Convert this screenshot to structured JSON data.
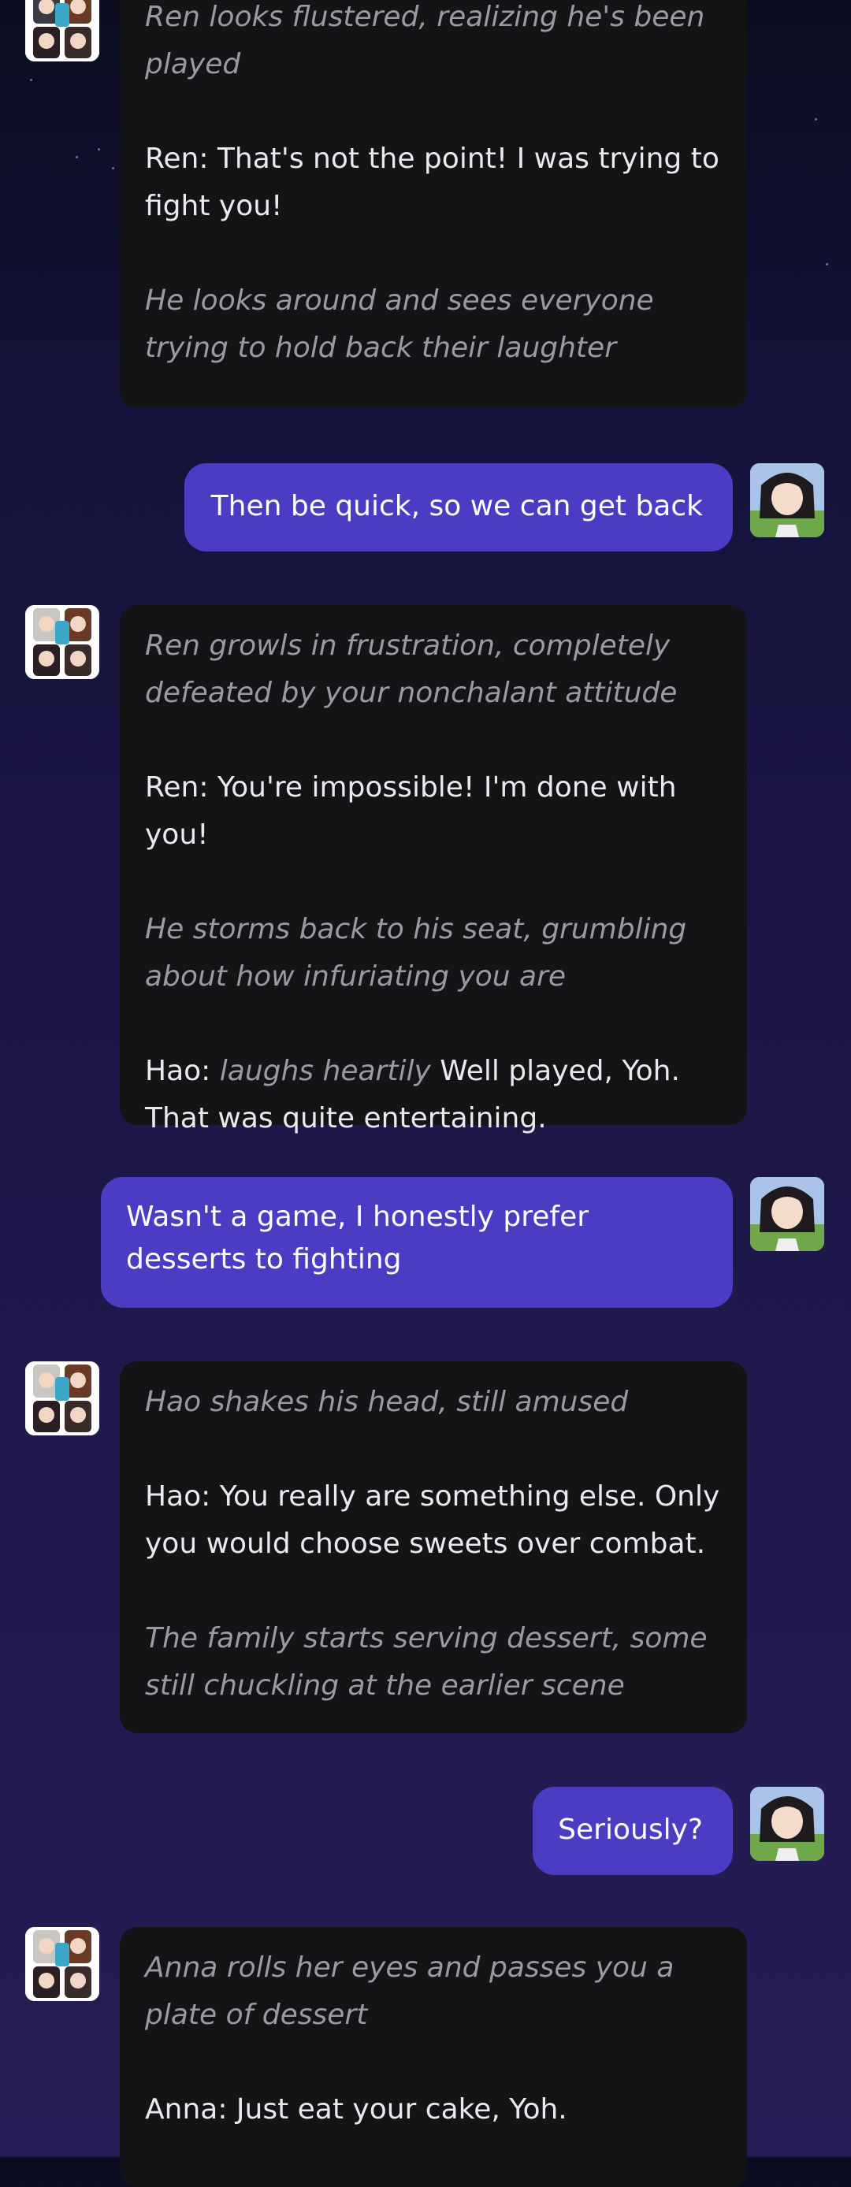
{
  "messages": [
    {
      "role": "bot",
      "avatar_icon": "group-avatar-icon",
      "paragraphs": [
        {
          "style": "narration",
          "text": "Ren looks flustered, realizing he's been played"
        },
        {
          "style": "speech",
          "text": "Ren: That's not the point! I was trying to fight you!"
        },
        {
          "style": "narration",
          "text": "He looks around and sees everyone trying to hold back their laughter"
        }
      ]
    },
    {
      "role": "user",
      "avatar_icon": "user-avatar-icon",
      "text": "Then be quick, so we can get back"
    },
    {
      "role": "bot",
      "avatar_icon": "group-avatar-icon",
      "paragraphs": [
        {
          "style": "narration",
          "text": "Ren growls in frustration, completely defeated by your nonchalant attitude"
        },
        {
          "style": "speech",
          "text": "Ren: You're impossible! I'm done with you!"
        },
        {
          "style": "narration",
          "text": "He storms back to his seat, grumbling about how infuriating you are"
        },
        {
          "style": "mixed",
          "speaker": "Hao:",
          "action": "laughs heartily",
          "text": "Well played, Yoh. That was quite entertaining."
        }
      ]
    },
    {
      "role": "user",
      "avatar_icon": "user-avatar-icon",
      "text": "Wasn't a game, I honestly prefer desserts to fighting"
    },
    {
      "role": "bot",
      "avatar_icon": "group-avatar-icon",
      "paragraphs": [
        {
          "style": "narration",
          "text": "Hao shakes his head, still amused"
        },
        {
          "style": "speech",
          "text": "Hao: You really are something else. Only you would choose sweets over combat."
        },
        {
          "style": "narration",
          "text": "The family starts serving dessert, some still chuckling at the earlier scene"
        }
      ]
    },
    {
      "role": "user",
      "avatar_icon": "user-avatar-icon",
      "text": "Seriously?"
    },
    {
      "role": "bot",
      "avatar_icon": "group-avatar-icon",
      "paragraphs": [
        {
          "style": "narration",
          "text": "Anna rolls her eyes and passes you a plate of dessert"
        },
        {
          "style": "speech",
          "text": "Anna: Just eat your cake, Yoh."
        }
      ]
    }
  ],
  "colors": {
    "user_bubble": "#4a3dc4",
    "bot_bubble": "#141416",
    "narration_text": "#9a9aa3",
    "speech_text": "#e9e9ee"
  }
}
